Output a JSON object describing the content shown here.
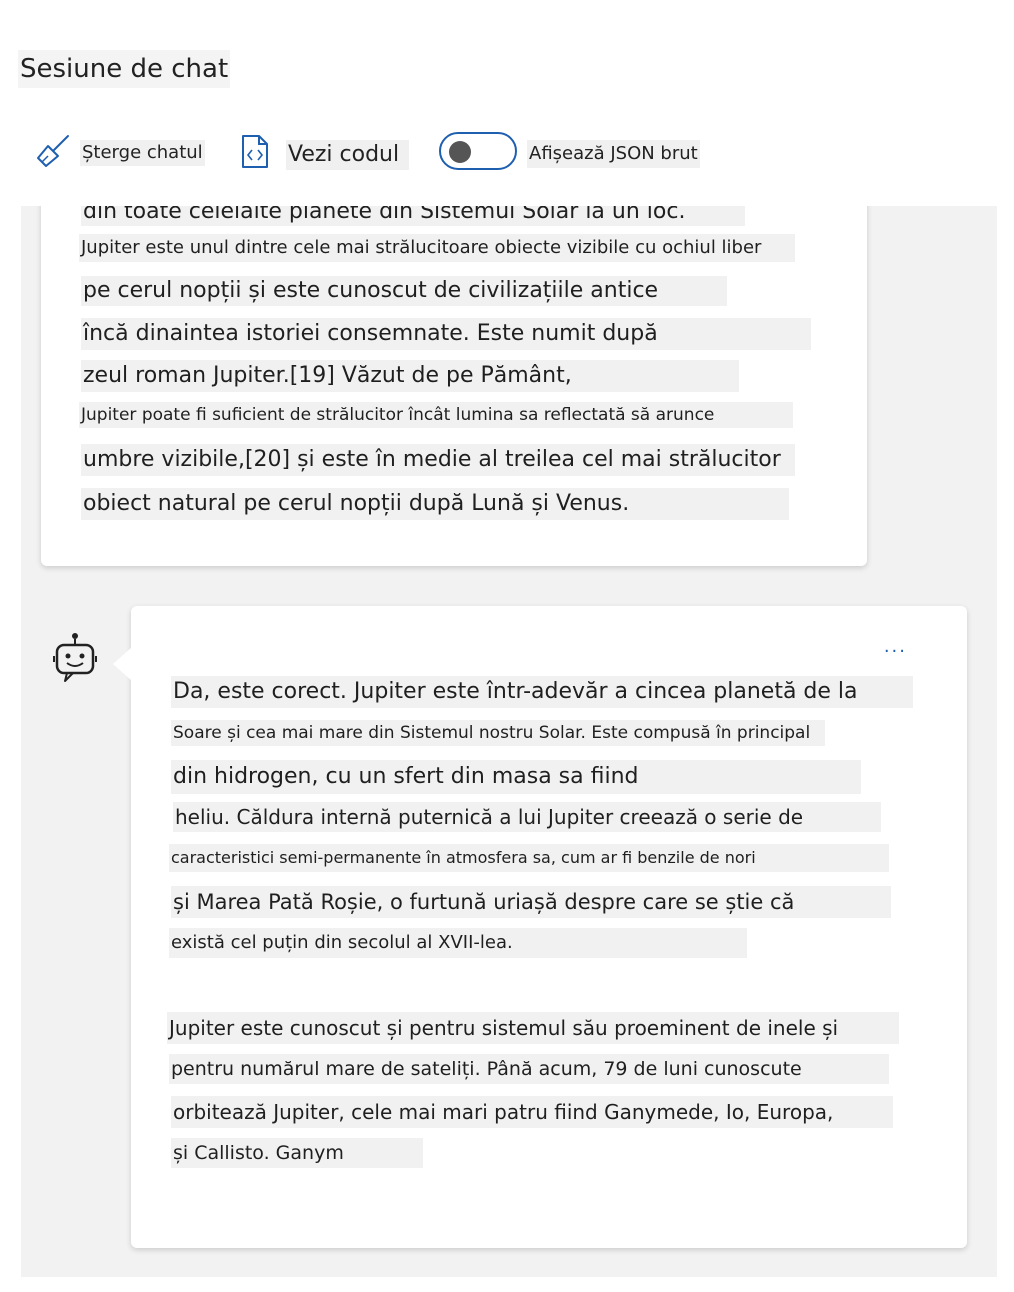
{
  "page": {
    "title": "Sesiune de chat"
  },
  "toolbar": {
    "clear_label": "Șterge chatul",
    "view_code_label": "Vezi codul",
    "raw_json_label": "Afișează JSON brut",
    "raw_json_enabled": false
  },
  "colors": {
    "accent": "#1f5fb0",
    "chat_background": "#f2f2f2",
    "card": "#ffffff"
  },
  "messages": {
    "user": {
      "lines": [
        "din toate celelalte planete din Sistemul Solar la un loc.",
        "Jupiter este unul dintre cele mai strălucitoare obiecte vizibile cu ochiul liber",
        "pe cerul nopții și este cunoscut de civilizațiile antice",
        "încă dinaintea istoriei consemnate. Este numit după",
        "zeul roman Jupiter.[19] Văzut de pe Pământ,",
        "Jupiter poate fi suficient de strălucitor încât lumina sa reflectată să arunce",
        "umbre vizibile,[20] și este în medie al treilea cel mai strălucitor",
        "obiect natural pe cerul nopții după Lună și Venus."
      ]
    },
    "assistant": {
      "avatar_icon": "robot-icon",
      "more_label": "...",
      "lines": [
        "Da, este corect. Jupiter este într-adevăr a cincea planetă de la",
        "Soare și cea mai mare din Sistemul nostru Solar. Este compusă în principal",
        "din hidrogen, cu un sfert din masa sa fiind",
        "heliu. Căldura internă puternică a lui Jupiter creează o serie de",
        "caracteristici semi-permanente în atmosfera sa, cum ar fi benzile de nori",
        "și Marea Pată Roșie, o furtună uriașă despre care se știe că",
        "există cel puțin din secolul al XVII-lea.",
        "Jupiter este cunoscut și pentru sistemul său proeminent de inele și",
        "pentru numărul mare de sateliți. Până acum, 79 de luni cunoscute",
        "orbitează Jupiter, cele mai mari patru fiind Ganymede, Io, Europa,",
        "și Callisto. Ganym"
      ]
    }
  }
}
